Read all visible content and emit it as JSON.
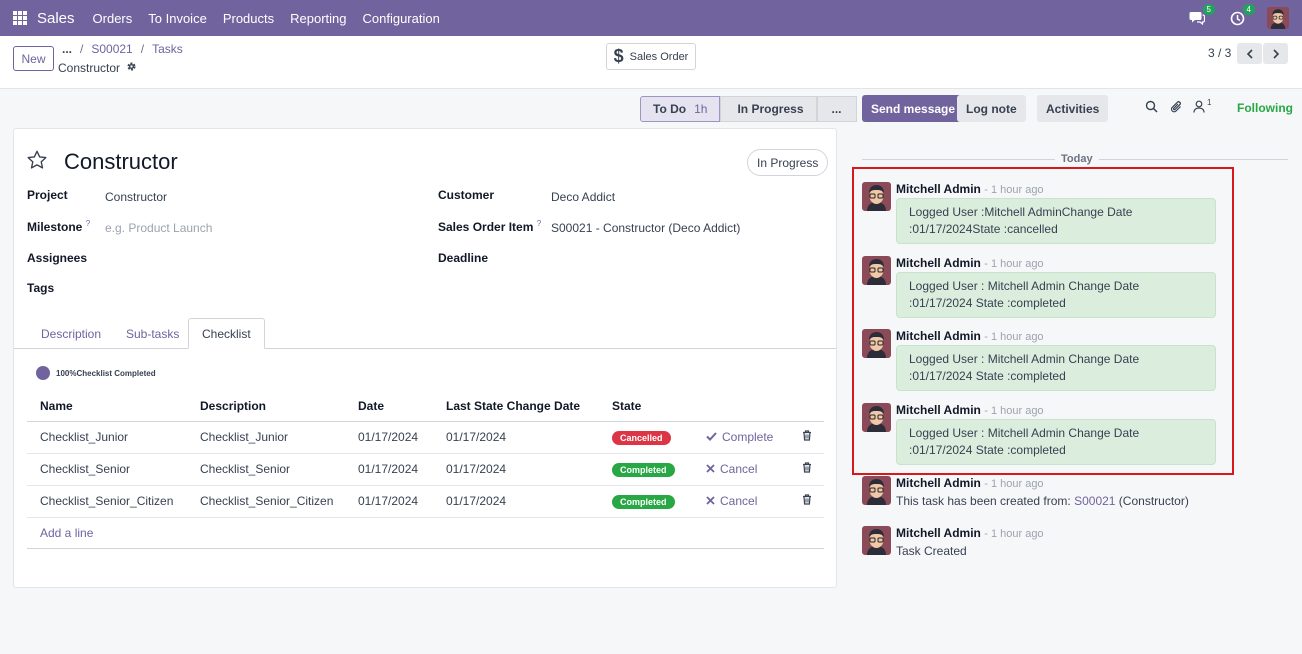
{
  "topbar": {
    "app_name": "Sales",
    "menu": [
      "Orders",
      "To Invoice",
      "Products",
      "Reporting",
      "Configuration"
    ],
    "messages_badge": "5",
    "activities_badge": "4"
  },
  "control_panel": {
    "new_label": "New",
    "breadcrumb_dots": "...",
    "breadcrumb": [
      "S00021",
      "Tasks"
    ],
    "record_name": "Constructor",
    "smart_button_label": "Sales Order",
    "pager": "3 / 3"
  },
  "statusbar": {
    "stages": [
      {
        "label": "To Do",
        "duration": "1h"
      },
      {
        "label": "In Progress"
      },
      {
        "label": "..."
      }
    ]
  },
  "form": {
    "title": "Constructor",
    "state_button": "In Progress",
    "fields": {
      "project_label": "Project",
      "project_value": "Constructor",
      "milestone_label": "Milestone",
      "milestone_placeholder": "e.g. Product Launch",
      "assignees_label": "Assignees",
      "tags_label": "Tags",
      "customer_label": "Customer",
      "customer_value": "Deco Addict",
      "so_item_label": "Sales Order Item",
      "so_item_value": "S00021 - Constructor (Deco Addict)",
      "deadline_label": "Deadline",
      "help_mark": "?"
    },
    "tabs": [
      "Description",
      "Sub-tasks",
      "Checklist"
    ],
    "checklist_progress": "100%Checklist Completed",
    "checklist": {
      "headers": [
        "Name",
        "Description",
        "Date",
        "Last State Change Date",
        "State"
      ],
      "rows": [
        {
          "name": "Checklist_Junior",
          "description": "Checklist_Junior",
          "date": "01/17/2024",
          "last_change": "01/17/2024",
          "state": "Cancelled",
          "action": "Complete"
        },
        {
          "name": "Checklist_Senior",
          "description": "Checklist_Senior",
          "date": "01/17/2024",
          "last_change": "01/17/2024",
          "state": "Completed",
          "action": "Cancel"
        },
        {
          "name": "Checklist_Senior_Citizen",
          "description": "Checklist_Senior_Citizen",
          "date": "01/17/2024",
          "last_change": "01/17/2024",
          "state": "Completed",
          "action": "Cancel"
        }
      ],
      "add_line": "Add a line"
    }
  },
  "chatter": {
    "send_message": "Send message",
    "log_note": "Log note",
    "activities": "Activities",
    "followers_count": "1",
    "following": "Following",
    "today": "Today",
    "messages": [
      {
        "author": "Mitchell Admin",
        "time": "- 1 hour ago",
        "line1": "Logged User :Mitchell AdminChange Date",
        "line2": ":01/17/2024State :cancelled"
      },
      {
        "author": "Mitchell Admin",
        "time": "- 1 hour ago",
        "line1": "Logged User : Mitchell Admin  Change Date",
        "line2": ":01/17/2024  State :completed"
      },
      {
        "author": "Mitchell Admin",
        "time": "- 1 hour ago",
        "line1": "Logged User : Mitchell Admin  Change Date",
        "line2": ":01/17/2024  State :completed"
      },
      {
        "author": "Mitchell Admin",
        "time": "- 1 hour ago",
        "line1": "Logged User : Mitchell Admin  Change Date",
        "line2": ":01/17/2024  State :completed"
      }
    ],
    "creation_note": {
      "author": "Mitchell Admin",
      "time": "- 1 hour ago",
      "prefix": "This task has been created from: ",
      "link": "S00021",
      "suffix": " (Constructor)"
    },
    "created_note": {
      "author": "Mitchell Admin",
      "time": "- 1 hour ago",
      "body": "Task Created"
    }
  }
}
